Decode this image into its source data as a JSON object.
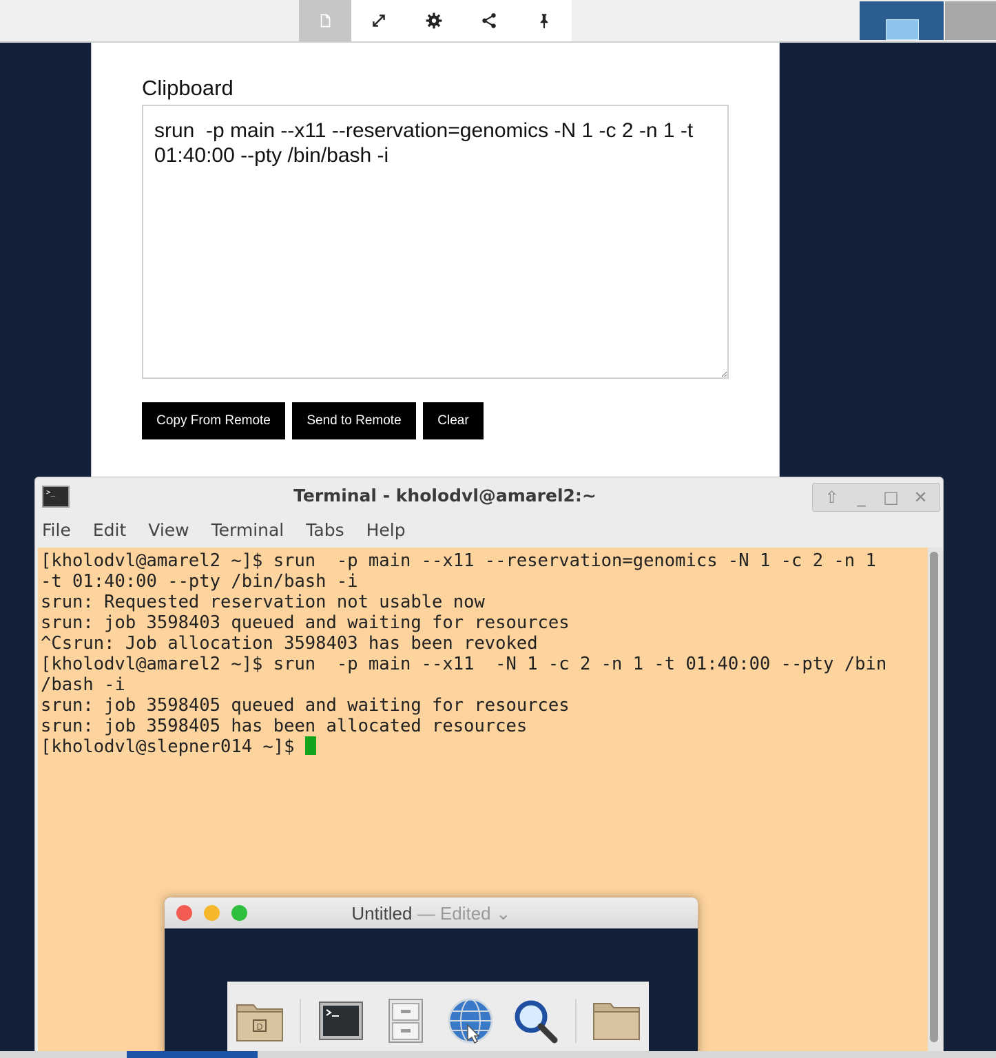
{
  "toolbar": {
    "icons": [
      "clipboard-icon",
      "fullscreen-icon",
      "gear-icon",
      "share-icon",
      "pin-icon"
    ]
  },
  "clipboard": {
    "title": "Clipboard",
    "text": "srun  -p main --x11 --reservation=genomics -N 1 -c 2 -n 1 -t 01:40:00 --pty /bin/bash -i",
    "buttons": {
      "copy_from_remote": "Copy From Remote",
      "send_to_remote": "Send to Remote",
      "clear": "Clear"
    }
  },
  "terminal": {
    "title": "Terminal - kholodvl@amarel2:~",
    "menu": [
      "File",
      "Edit",
      "View",
      "Terminal",
      "Tabs",
      "Help"
    ],
    "lines": [
      "[kholodvl@amarel2 ~]$ srun  -p main --x11 --reservation=genomics -N 1 -c 2 -n 1",
      "-t 01:40:00 --pty /bin/bash -i",
      "srun: Requested reservation not usable now",
      "srun: job 3598403 queued and waiting for resources",
      "^Csrun: Job allocation 3598403 has been revoked",
      "[kholodvl@amarel2 ~]$ srun  -p main --x11  -N 1 -c 2 -n 1 -t 01:40:00 --pty /bin",
      "/bash -i",
      "srun: job 3598405 queued and waiting for resources",
      "srun: job 3598405 has been allocated resources"
    ],
    "prompt": "[kholodvl@slepner014 ~]$ ",
    "cursor_color": "#13a31d",
    "background_color": "#fdd39e"
  },
  "mac_window": {
    "title": "Untitled",
    "separator": " — ",
    "status": "Edited",
    "status_chevron": "⌄",
    "traffic_colors": [
      "#f25b52",
      "#f6b72c",
      "#2fc03f"
    ],
    "dock": [
      "home-folder-icon",
      "terminal-icon",
      "file-cabinet-icon",
      "web-browser-icon",
      "search-icon",
      "folder-icon"
    ]
  },
  "colors": {
    "desktop": "#13203a",
    "button_bg": "#000000",
    "toolbar_active": "#c6c6c6"
  }
}
